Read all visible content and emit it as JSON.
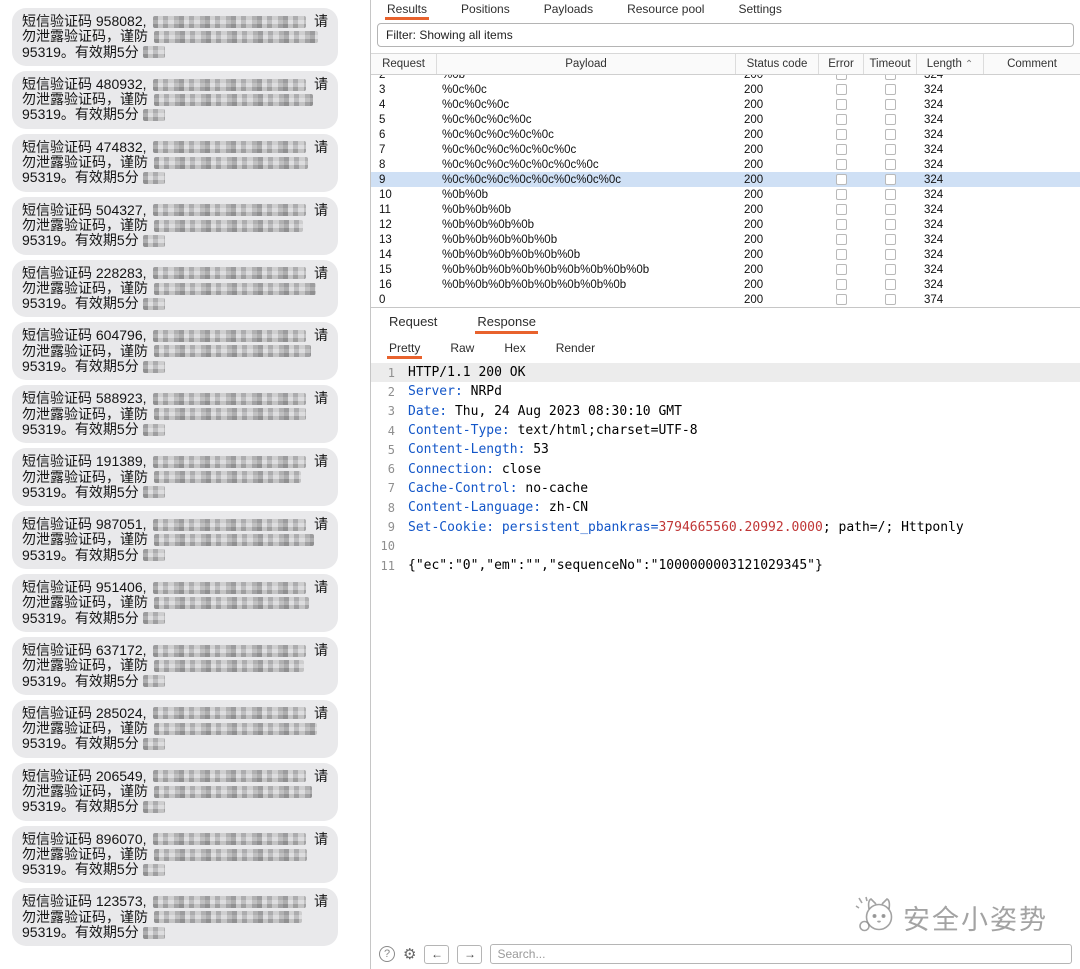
{
  "sms": {
    "bubble_line1_prefix": "短信验证码",
    "bubble_line1_tail": "请",
    "bubble_line2": "勿泄露验证码，谨防",
    "bubble_line3": "95319。有效期5分",
    "codes": [
      "958082",
      "480932",
      "474832",
      "504327",
      "228283",
      "604796",
      "588923",
      "191389",
      "987051",
      "951406",
      "637172",
      "285024",
      "206549",
      "896070",
      "123573"
    ]
  },
  "intruder": {
    "tabs": [
      {
        "label": "Results",
        "active": true
      },
      {
        "label": "Positions",
        "active": false
      },
      {
        "label": "Payloads",
        "active": false
      },
      {
        "label": "Resource pool",
        "active": false
      },
      {
        "label": "Settings",
        "active": false
      }
    ],
    "filter_text": "Filter: Showing all items",
    "table": {
      "columns": [
        "Request",
        "Payload",
        "Status code",
        "Error",
        "Timeout",
        "Length",
        "Comment"
      ],
      "sort_column": "Length",
      "sort_indicator": "⌃",
      "rows": [
        {
          "request": "2",
          "payload": "%0b",
          "status": "200",
          "error": false,
          "timeout": false,
          "length": "324",
          "comment": "",
          "selected": false,
          "partial": true
        },
        {
          "request": "3",
          "payload": "%0c%0c",
          "status": "200",
          "error": false,
          "timeout": false,
          "length": "324",
          "comment": "",
          "selected": false
        },
        {
          "request": "4",
          "payload": "%0c%0c%0c",
          "status": "200",
          "error": false,
          "timeout": false,
          "length": "324",
          "comment": "",
          "selected": false
        },
        {
          "request": "5",
          "payload": "%0c%0c%0c%0c",
          "status": "200",
          "error": false,
          "timeout": false,
          "length": "324",
          "comment": "",
          "selected": false
        },
        {
          "request": "6",
          "payload": "%0c%0c%0c%0c%0c",
          "status": "200",
          "error": false,
          "timeout": false,
          "length": "324",
          "comment": "",
          "selected": false
        },
        {
          "request": "7",
          "payload": "%0c%0c%0c%0c%0c%0c",
          "status": "200",
          "error": false,
          "timeout": false,
          "length": "324",
          "comment": "",
          "selected": false
        },
        {
          "request": "8",
          "payload": "%0c%0c%0c%0c%0c%0c%0c",
          "status": "200",
          "error": false,
          "timeout": false,
          "length": "324",
          "comment": "",
          "selected": false
        },
        {
          "request": "9",
          "payload": "%0c%0c%0c%0c%0c%0c%0c%0c",
          "status": "200",
          "error": false,
          "timeout": false,
          "length": "324",
          "comment": "",
          "selected": true
        },
        {
          "request": "10",
          "payload": "%0b%0b",
          "status": "200",
          "error": false,
          "timeout": false,
          "length": "324",
          "comment": "",
          "selected": false
        },
        {
          "request": "11",
          "payload": "%0b%0b%0b",
          "status": "200",
          "error": false,
          "timeout": false,
          "length": "324",
          "comment": "",
          "selected": false
        },
        {
          "request": "12",
          "payload": "%0b%0b%0b%0b",
          "status": "200",
          "error": false,
          "timeout": false,
          "length": "324",
          "comment": "",
          "selected": false
        },
        {
          "request": "13",
          "payload": "%0b%0b%0b%0b%0b",
          "status": "200",
          "error": false,
          "timeout": false,
          "length": "324",
          "comment": "",
          "selected": false
        },
        {
          "request": "14",
          "payload": "%0b%0b%0b%0b%0b%0b",
          "status": "200",
          "error": false,
          "timeout": false,
          "length": "324",
          "comment": "",
          "selected": false
        },
        {
          "request": "15",
          "payload": "%0b%0b%0b%0b%0b%0b%0b%0b%0b",
          "status": "200",
          "error": false,
          "timeout": false,
          "length": "324",
          "comment": "",
          "selected": false
        },
        {
          "request": "16",
          "payload": "%0b%0b%0b%0b%0b%0b%0b%0b",
          "status": "200",
          "error": false,
          "timeout": false,
          "length": "324",
          "comment": "",
          "selected": false
        },
        {
          "request": "0",
          "payload": "",
          "status": "200",
          "error": false,
          "timeout": false,
          "length": "374",
          "comment": "",
          "selected": false
        }
      ]
    },
    "message_tabs": [
      {
        "label": "Request",
        "active": false
      },
      {
        "label": "Response",
        "active": true
      }
    ],
    "view_tabs": [
      {
        "label": "Pretty",
        "active": true
      },
      {
        "label": "Raw",
        "active": false
      },
      {
        "label": "Hex",
        "active": false
      },
      {
        "label": "Render",
        "active": false
      }
    ],
    "response": {
      "lines": [
        {
          "no": "1",
          "highlight": true,
          "segments": [
            [
              "p",
              "HTTP/1.1 200 OK"
            ]
          ]
        },
        {
          "no": "2",
          "highlight": false,
          "segments": [
            [
              "k",
              "Server:"
            ],
            [
              "p",
              " NRPd"
            ]
          ]
        },
        {
          "no": "3",
          "highlight": false,
          "segments": [
            [
              "k",
              "Date:"
            ],
            [
              "p",
              " Thu, 24 Aug 2023 08:30:10 GMT"
            ]
          ]
        },
        {
          "no": "4",
          "highlight": false,
          "segments": [
            [
              "k",
              "Content-Type:"
            ],
            [
              "p",
              " text/html;charset=UTF-8"
            ]
          ]
        },
        {
          "no": "5",
          "highlight": false,
          "segments": [
            [
              "k",
              "Content-Length:"
            ],
            [
              "p",
              " 53"
            ]
          ]
        },
        {
          "no": "6",
          "highlight": false,
          "segments": [
            [
              "k",
              "Connection:"
            ],
            [
              "p",
              " close"
            ]
          ]
        },
        {
          "no": "7",
          "highlight": false,
          "segments": [
            [
              "k",
              "Cache-Control:"
            ],
            [
              "p",
              " no-cache"
            ]
          ]
        },
        {
          "no": "8",
          "highlight": false,
          "segments": [
            [
              "k",
              "Content-Language:"
            ],
            [
              "p",
              " zh-CN"
            ]
          ]
        },
        {
          "no": "9",
          "highlight": false,
          "segments": [
            [
              "k",
              "Set-Cookie:"
            ],
            [
              "p",
              " "
            ],
            [
              "k",
              "persistent_pbankras="
            ],
            [
              "r",
              "3794665560.20992.0000"
            ],
            [
              "p",
              "; path=/; Httponly"
            ]
          ]
        },
        {
          "no": "10",
          "highlight": false,
          "segments": []
        },
        {
          "no": "11",
          "highlight": false,
          "segments": [
            [
              "p",
              "{\"ec\":\"0\",\"em\":\"\",\"sequenceNo\":\"1000000003121029345\"}"
            ]
          ]
        }
      ]
    },
    "toolbar": {
      "icons": {
        "help": "?",
        "gear": "⚙",
        "back": "←",
        "forward": "→"
      },
      "search_placeholder": "Search..."
    }
  },
  "watermark_text": "安全小姿势",
  "colors": {
    "accent_orange": "#e8622d",
    "selected_row_blue": "#cfe0f5",
    "header_key_blue": "#1356c8",
    "cookie_value_red": "#c03636"
  }
}
